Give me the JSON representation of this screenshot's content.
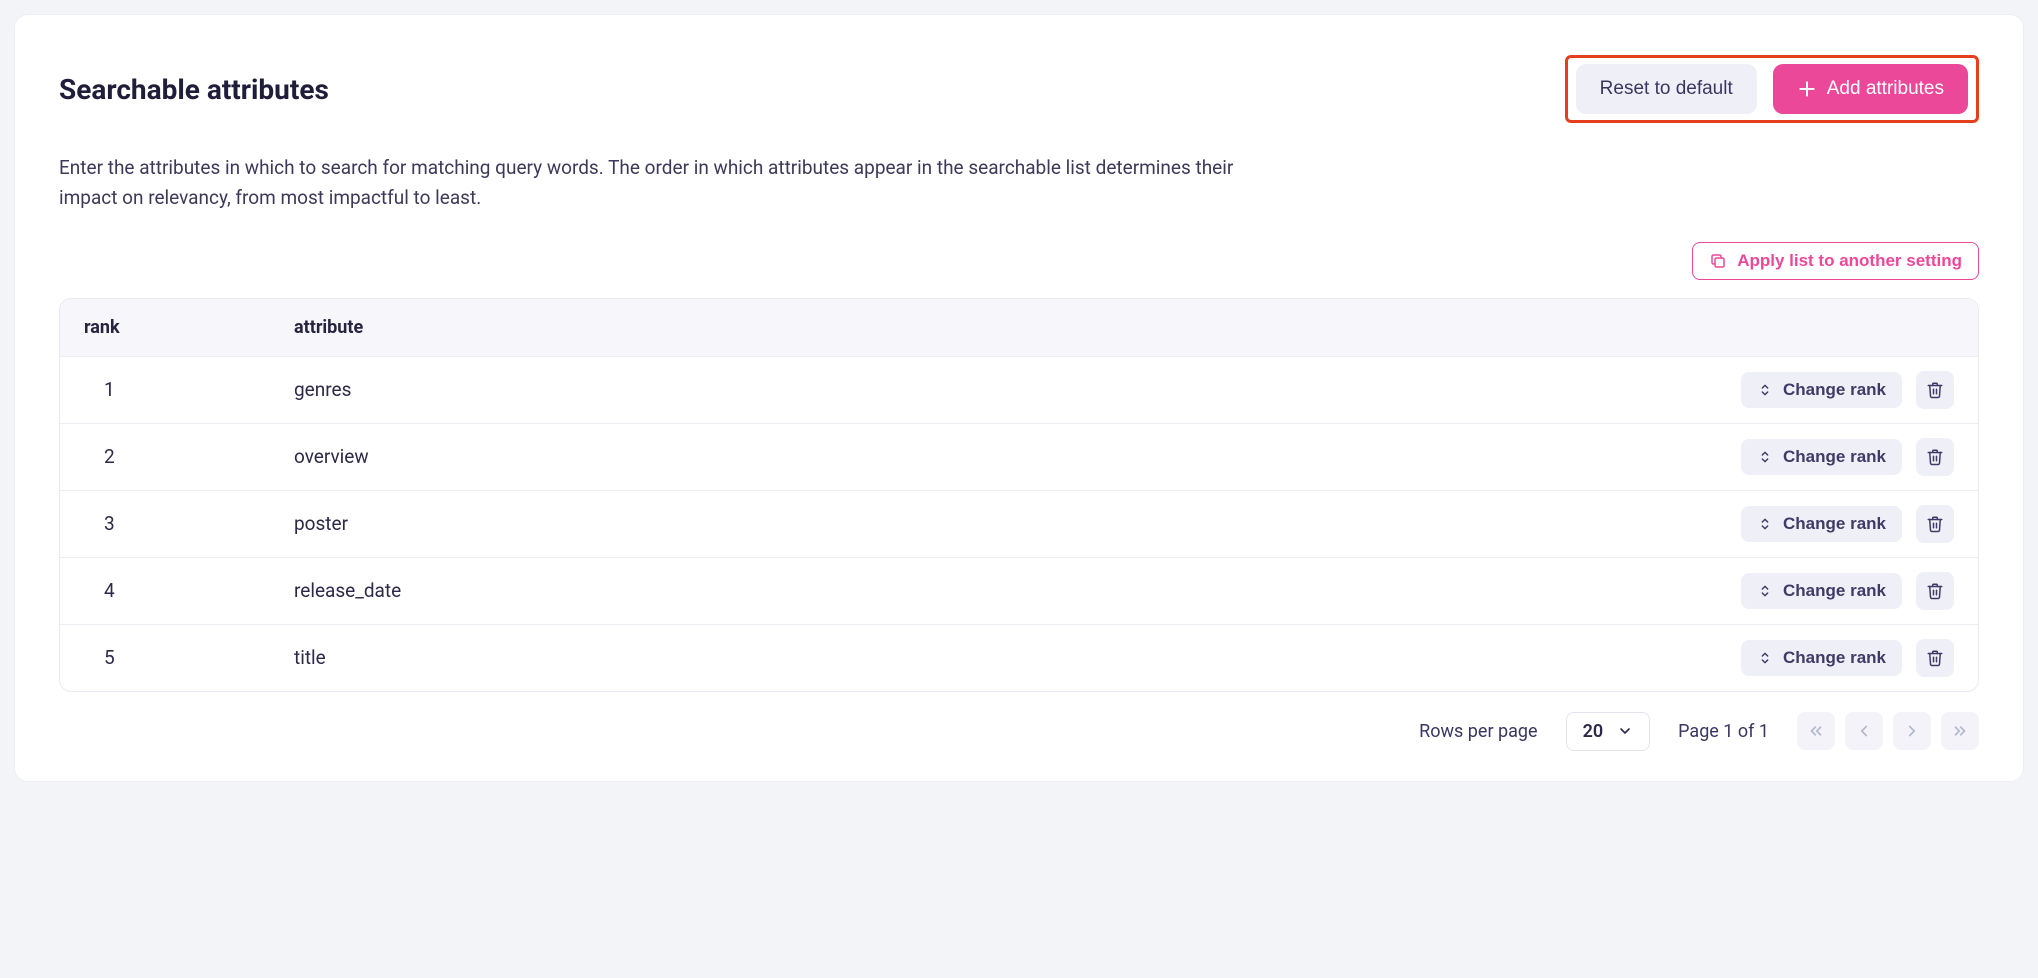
{
  "header": {
    "title": "Searchable attributes",
    "reset_label": "Reset to default",
    "add_label": "Add attributes"
  },
  "description": "Enter the attributes in which to search for matching query words. The order in which attributes appear in the searchable list determines their impact on relevancy, from most impactful to least.",
  "apply_button": "Apply list to another setting",
  "table": {
    "columns": {
      "rank": "rank",
      "attribute": "attribute"
    },
    "change_rank_label": "Change rank",
    "rows": [
      {
        "rank": "1",
        "attribute": "genres"
      },
      {
        "rank": "2",
        "attribute": "overview"
      },
      {
        "rank": "3",
        "attribute": "poster"
      },
      {
        "rank": "4",
        "attribute": "release_date"
      },
      {
        "rank": "5",
        "attribute": "title"
      }
    ]
  },
  "pagination": {
    "rows_per_page_label": "Rows per page",
    "rows_per_page_value": "20",
    "page_text": "Page 1 of 1"
  }
}
